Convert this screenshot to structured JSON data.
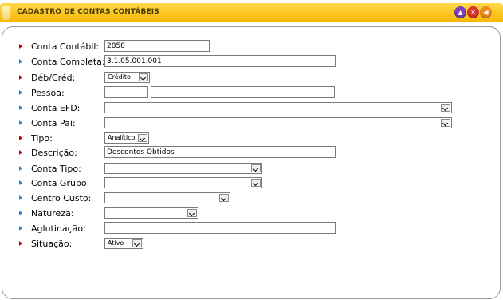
{
  "window": {
    "title": "CADASTRO DE CONTAS CONTÁBEIS"
  },
  "fields": {
    "conta_contabil": {
      "label": "Conta Contábil:",
      "value": "2858"
    },
    "conta_completa": {
      "label": "Conta Completa:",
      "value": "3.1.05.001.001"
    },
    "deb_cred": {
      "label": "Déb/Créd:",
      "value": "Crédito"
    },
    "pessoa": {
      "label": "Pessoa:",
      "code": "",
      "name": ""
    },
    "conta_efd": {
      "label": "Conta EFD:",
      "value": ""
    },
    "conta_pai": {
      "label": "Conta Pai:",
      "value": ""
    },
    "tipo": {
      "label": "Tipo:",
      "value": "Analítico"
    },
    "descricao": {
      "label": "Descrição:",
      "value": "Descontos Obtidos"
    },
    "conta_tipo": {
      "label": "Conta Tipo:",
      "value": ""
    },
    "conta_grupo": {
      "label": "Conta Grupo:",
      "value": ""
    },
    "centro_custo": {
      "label": "Centro Custo:",
      "value": ""
    },
    "natureza": {
      "label": "Natureza:",
      "value": ""
    },
    "aglutinacao": {
      "label": "Aglutinação:",
      "value": ""
    },
    "situacao": {
      "label": "Situação:",
      "value": "Ativo"
    }
  },
  "colors": {
    "required_marker": "#c00000",
    "optional_marker": "#2f7fd0",
    "titlebar": "#f6b800"
  },
  "icons": {
    "up": "arrow-up-icon",
    "close": "close-icon",
    "back": "arrow-left-icon"
  }
}
